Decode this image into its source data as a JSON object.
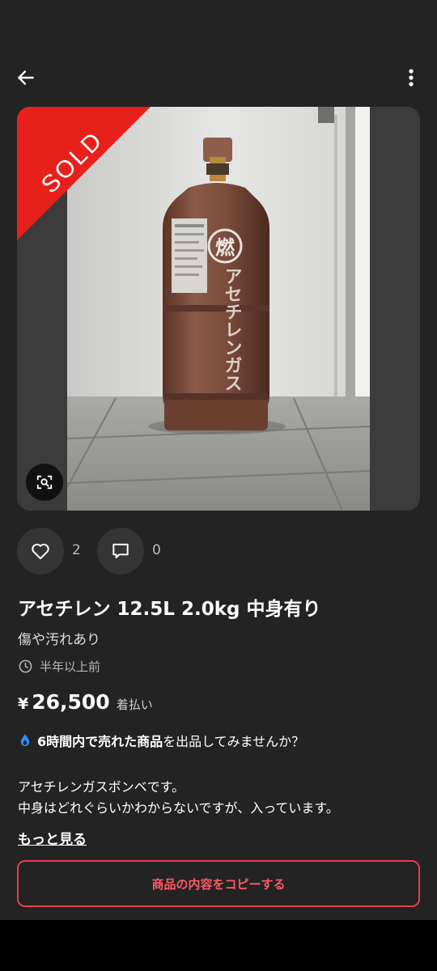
{
  "app_bar": {
    "back_icon": "arrow-left-icon",
    "more_icon": "more-vertical-icon"
  },
  "photo": {
    "sold_label": "SOLD",
    "lens_icon": "image-search-icon",
    "cylinder_mark": "燃",
    "cylinder_text": "アセチレンガス"
  },
  "actions": {
    "like_icon": "heart-icon",
    "like_count": "2",
    "comment_icon": "comment-icon",
    "comment_count": "0"
  },
  "item": {
    "title": "アセチレン 12.5L 2.0kg 中身有り",
    "condition": "傷や汚れあり",
    "time_icon": "clock-icon",
    "posted": "半年以上前",
    "currency": "¥",
    "price": "26,500",
    "shipping": "着払い"
  },
  "promo": {
    "icon": "fire-drop-icon",
    "bold_text": "6時間内で売れた商品",
    "rest_text": "を出品してみませんか？"
  },
  "description": {
    "line1": "アセチレンガスボンベです。",
    "line2": "中身はどれぐらいかわからないですが、入っています。",
    "more_label": "もっと見る"
  },
  "copy_button": {
    "label": "商品の内容をコピーする"
  },
  "colors": {
    "background": "#232323",
    "sold_red": "#e8201b",
    "accent_red": "#ff5a64",
    "promo_blue": "#2f8cf0"
  }
}
